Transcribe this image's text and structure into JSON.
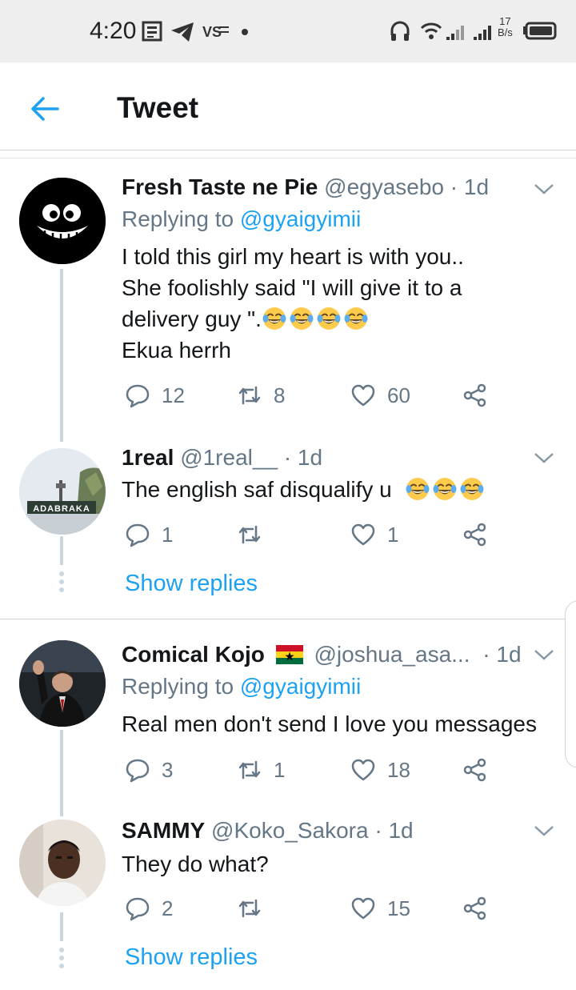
{
  "status_bar": {
    "time": "4:20",
    "speed_value": "17",
    "speed_unit": "B/s"
  },
  "header": {
    "title": "Tweet"
  },
  "tweets": [
    {
      "name": "Fresh Taste ne Pie",
      "handle": "@egyasebo",
      "time": "· 1d",
      "replying_prefix": "Replying to",
      "replying_to": "@gyaigyimii",
      "lines": [
        "I told this girl my heart is with you..",
        "She foolishly said \"I will give it to a",
        "delivery guy \"."
      ],
      "last_line": "Ekua  herrh",
      "emoji_count": 4,
      "replies": "12",
      "retweets": "8",
      "likes": "60"
    },
    {
      "name": "1real",
      "handle": "@1real__",
      "time": "· 1d",
      "text": "The english saf disqualify u",
      "replies": "1",
      "retweets": "",
      "likes": "1",
      "avatar_caption": "ADABRAKA"
    },
    {
      "name": "Comical Kojo",
      "handle": "@joshua_asa...",
      "time": "· 1d",
      "replying_prefix": "Replying to",
      "replying_to": "@gyaigyimii",
      "text": "Real men don't send I love you messages",
      "replies": "3",
      "retweets": "1",
      "likes": "18"
    },
    {
      "name": "SAMMY",
      "handle": "@Koko_Sakora",
      "time": "· 1d",
      "text": "They do what?",
      "replies": "2",
      "retweets": "",
      "likes": "15"
    }
  ],
  "show_replies_label": "Show replies",
  "colors": {
    "accent": "#1da1f2",
    "secondary_text": "#657786",
    "thread_line": "#ccd6dd"
  }
}
